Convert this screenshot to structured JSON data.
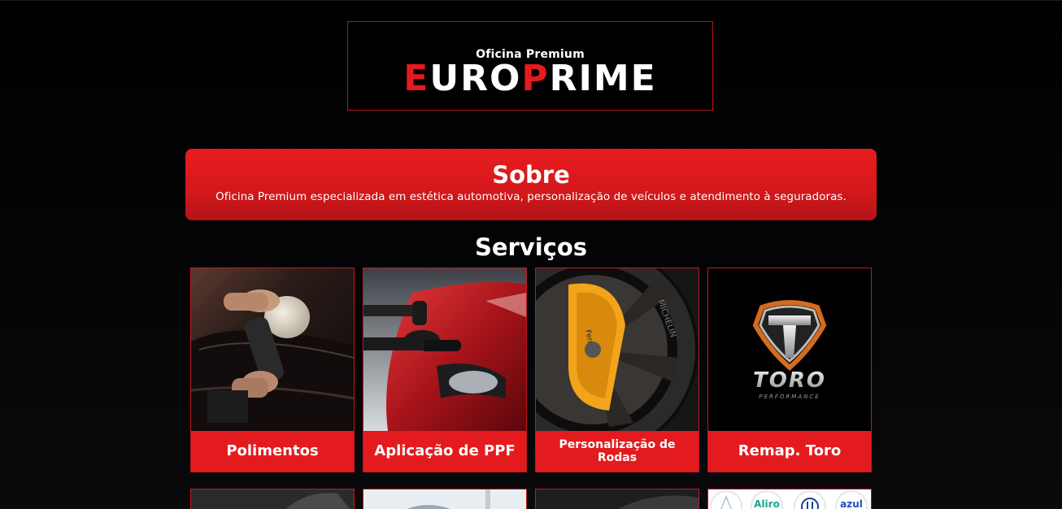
{
  "header": {
    "logo_subtitle": "Oficina Premium",
    "logo_parts": [
      "E",
      "URO",
      "P",
      "RIME"
    ],
    "brand_red": "#e41b1e"
  },
  "about": {
    "title": "Sobre",
    "text": "Oficina Premium especializada em estética automotiva, personalização de veículos e atendimento à seguradoras."
  },
  "services": {
    "title": "Serviços",
    "cards": [
      {
        "label": "Polimentos",
        "icon": "polisher-photo"
      },
      {
        "label": "Aplicação de PPF",
        "icon": "red-car-ppf-photo"
      },
      {
        "label": "Personalização de Rodas",
        "icon": "wheel-brake-photo"
      },
      {
        "label": "Remap. Toro",
        "icon": "toro-performance-logo"
      }
    ],
    "partners": {
      "badges": [
        "Aliro",
        "azul"
      ]
    },
    "toro_logo_text": [
      "TORO",
      "PERFORMANCE"
    ]
  },
  "colors": {
    "accent": "#e41b1e",
    "background": "#000000",
    "text": "#ffffff"
  }
}
